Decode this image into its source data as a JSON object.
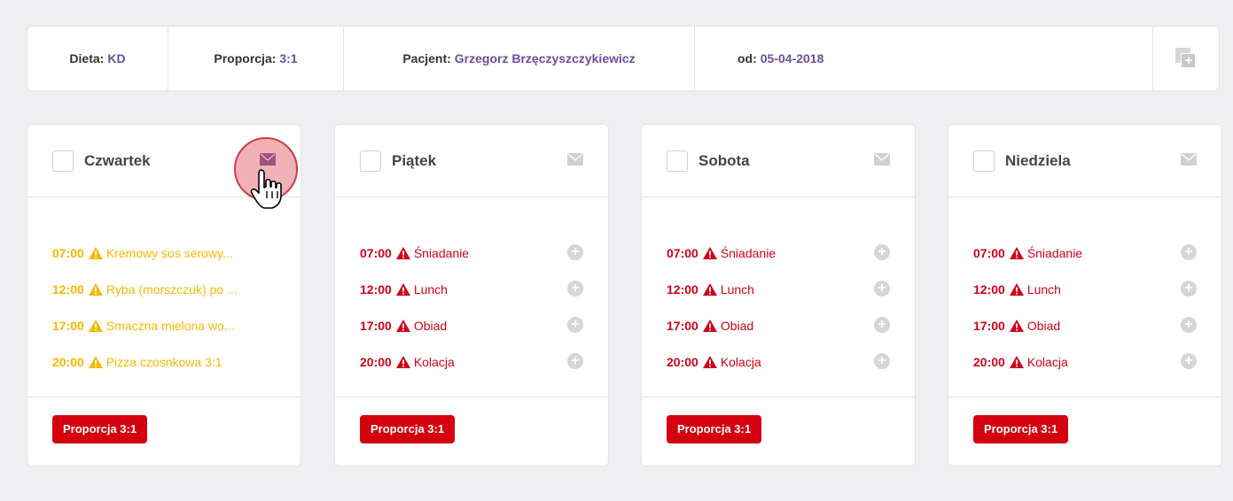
{
  "header": {
    "dieta_label": "Dieta:",
    "dieta_value": "KD",
    "proporcja_label": "Proporcja:",
    "proporcja_value": "3:1",
    "pacjent_label": "Pacjent:",
    "pacjent_value": "Grzegorz Brzęczyszczykiewicz",
    "od_label": "od:",
    "od_value": "05-04-2018",
    "copy_icon": "copy-add-icon"
  },
  "colors": {
    "accent": "#6a4e9c",
    "warning_yellow": "#f5b900",
    "error_red": "#d0021b",
    "button_red": "#d4000f"
  },
  "days": [
    {
      "title": "Czwartek",
      "mail_active": true,
      "meals": [
        {
          "time": "07:00",
          "name": "Kremowy sos serowy...",
          "status": "yellow"
        },
        {
          "time": "12:00",
          "name": "Ryba (morszczuk) po ...",
          "status": "yellow"
        },
        {
          "time": "17:00",
          "name": "Smaczna mielona wo...",
          "status": "yellow"
        },
        {
          "time": "20:00",
          "name": "Pizza czosnkowa 3:1",
          "status": "yellow"
        }
      ],
      "button": "Proporcja 3:1"
    },
    {
      "title": "Piątek",
      "mail_active": false,
      "meals": [
        {
          "time": "07:00",
          "name": "Śniadanie",
          "status": "red"
        },
        {
          "time": "12:00",
          "name": "Lunch",
          "status": "red"
        },
        {
          "time": "17:00",
          "name": "Obiad",
          "status": "red"
        },
        {
          "time": "20:00",
          "name": "Kolacja",
          "status": "red"
        }
      ],
      "button": "Proporcja 3:1"
    },
    {
      "title": "Sobota",
      "mail_active": false,
      "meals": [
        {
          "time": "07:00",
          "name": "Śniadanie",
          "status": "red"
        },
        {
          "time": "12:00",
          "name": "Lunch",
          "status": "red"
        },
        {
          "time": "17:00",
          "name": "Obiad",
          "status": "red"
        },
        {
          "time": "20:00",
          "name": "Kolacja",
          "status": "red"
        }
      ],
      "button": "Proporcja 3:1"
    },
    {
      "title": "Niedziela",
      "mail_active": false,
      "meals": [
        {
          "time": "07:00",
          "name": "Śniadanie",
          "status": "red"
        },
        {
          "time": "12:00",
          "name": "Lunch",
          "status": "red"
        },
        {
          "time": "17:00",
          "name": "Obiad",
          "status": "red"
        },
        {
          "time": "20:00",
          "name": "Kolacja",
          "status": "red"
        }
      ],
      "button": "Proporcja 3:1"
    }
  ]
}
